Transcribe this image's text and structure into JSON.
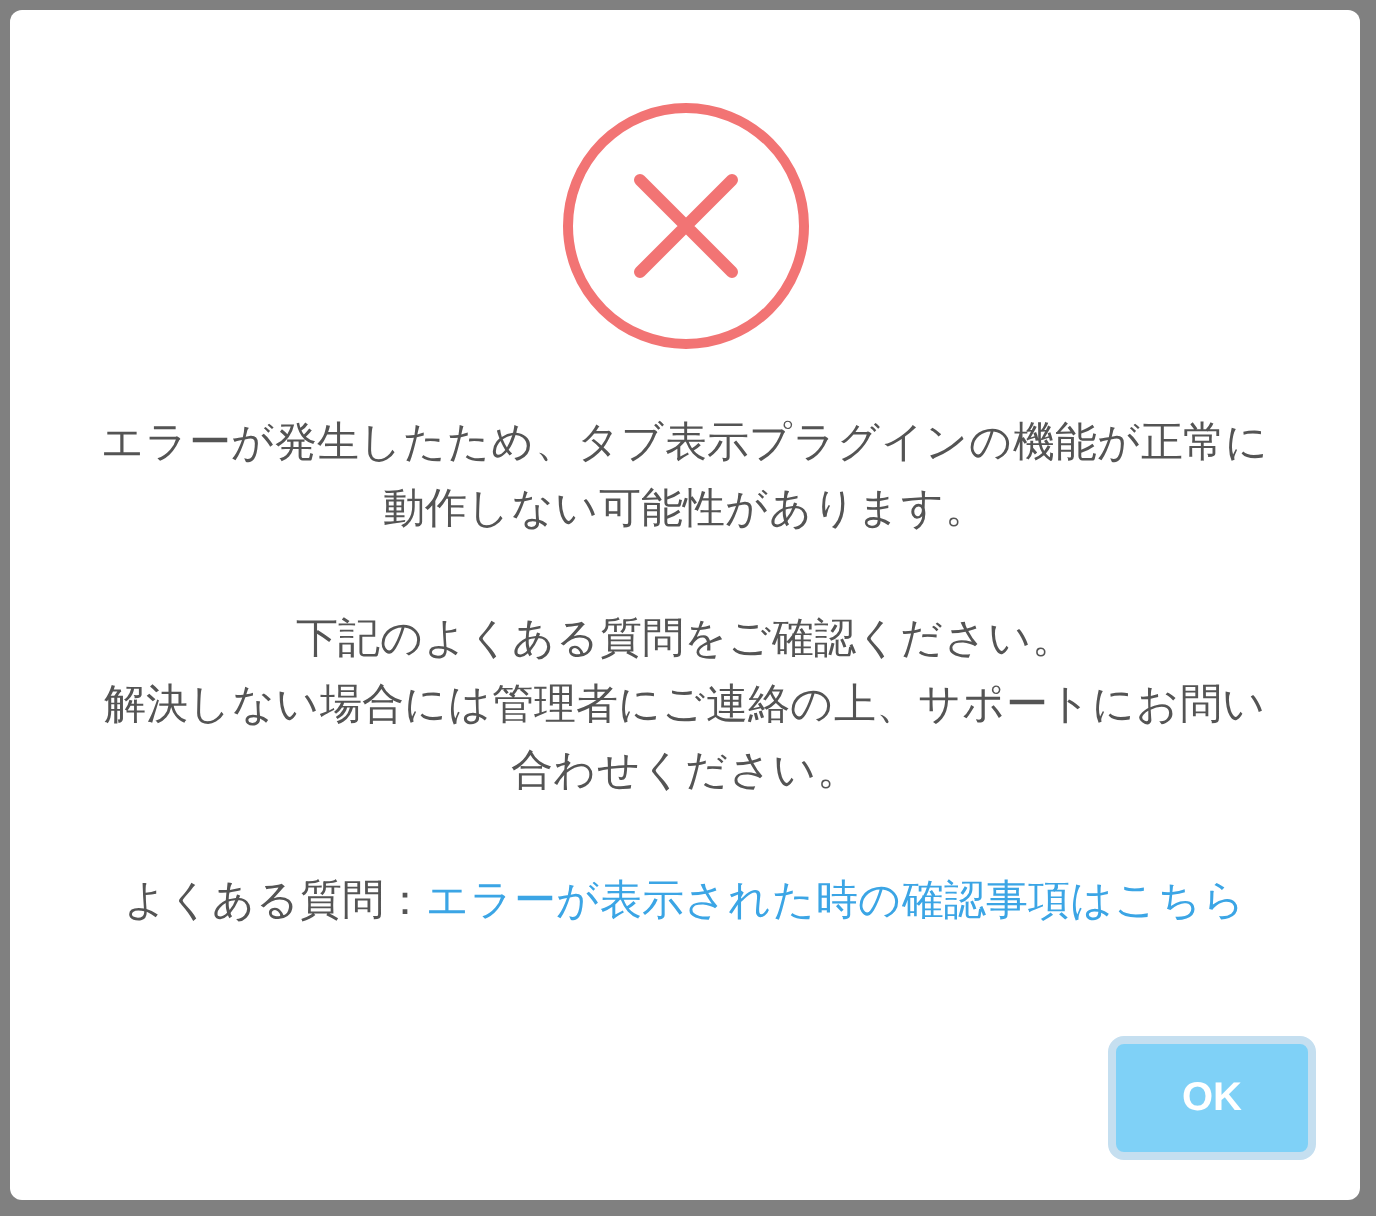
{
  "dialog": {
    "kind": "error",
    "paragraphs": [
      {
        "lines": [
          "エラーが発生したため、タブ表示プラグインの機能が正常に",
          "動作しない可能性があります。"
        ]
      },
      {
        "lines": [
          "下記のよくある質問をご確認ください。",
          "解決しない場合には管理者にご連絡の上、サポートにお問い",
          "合わせください。"
        ]
      }
    ],
    "faq": {
      "label": "よくある質問：",
      "link": "エラーが表示された時の確認事項はこちら"
    },
    "buttons": [
      "OK"
    ]
  }
}
